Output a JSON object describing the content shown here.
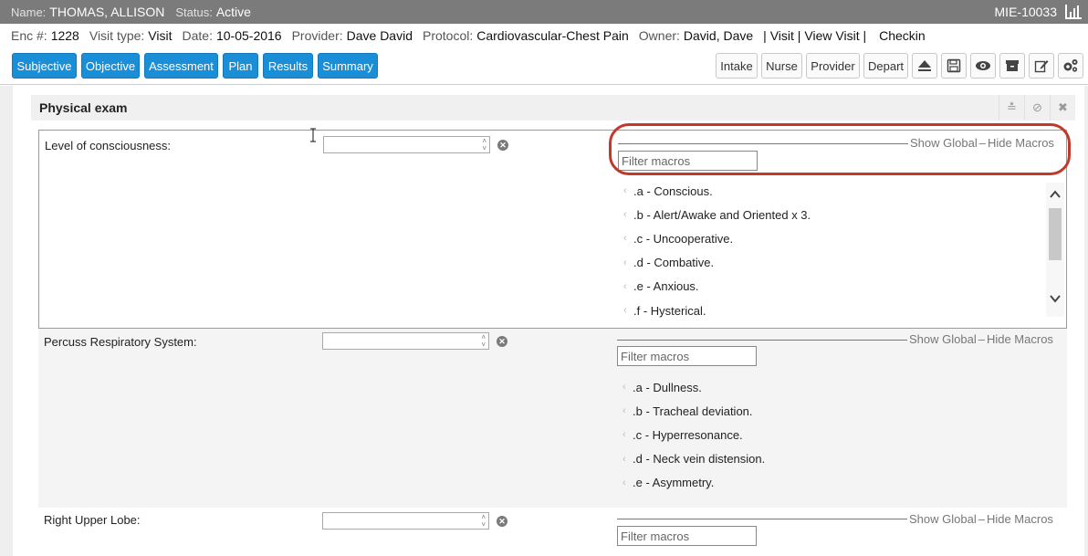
{
  "patient": {
    "name_label": "Name:",
    "name": "THOMAS, ALLISON",
    "status_label": "Status:",
    "status": "Active",
    "mrn": "MIE-10033"
  },
  "encounter": {
    "enc_label": "Enc #:",
    "enc": "1228",
    "visit_type_label": "Visit type:",
    "visit_type": "Visit",
    "date_label": "Date:",
    "date": "10-05-2016",
    "provider_label": "Provider:",
    "provider": "Dave David",
    "protocol_label": "Protocol:",
    "protocol": "Cardiovascular-Chest Pain",
    "owner_label": "Owner:",
    "owner": "David, Dave",
    "links": [
      "| Visit |",
      "View Visit |"
    ],
    "checkin": "Checkin"
  },
  "tabs": [
    "Subjective",
    "Objective",
    "Assessment",
    "Plan",
    "Results",
    "Summary"
  ],
  "role_buttons": [
    "Intake",
    "Nurse",
    "Provider",
    "Depart"
  ],
  "toolbar_icons": [
    "eject-icon",
    "save-icon",
    "eye-icon",
    "archive-icon",
    "edit-icon",
    "settings-icon"
  ],
  "physical_exam": {
    "title": "Physical exam"
  },
  "macro_controls": {
    "show_global": "Show Global",
    "hide_macros": "Hide Macros",
    "filter_placeholder": "Filter macros"
  },
  "sections": [
    {
      "label": "Level of consciousness:",
      "macros": [
        ".a - Conscious.",
        ".b - Alert/Awake and Oriented x 3.",
        ".c - Uncooperative.",
        ".d - Combative.",
        ".e - Anxious.",
        ".f - Hysterical."
      ]
    },
    {
      "label": "Percuss Respiratory System:",
      "macros": [
        ".a - Dullness.",
        ".b - Tracheal deviation.",
        ".c - Hyperresonance.",
        ".d - Neck vein distension.",
        ".e - Asymmetry."
      ]
    },
    {
      "label": "Right Upper Lobe:",
      "macros": []
    }
  ],
  "colors": {
    "accent": "#1a8fd8",
    "highlight": "#c0392b",
    "header_bar": "#7b7b7b"
  }
}
